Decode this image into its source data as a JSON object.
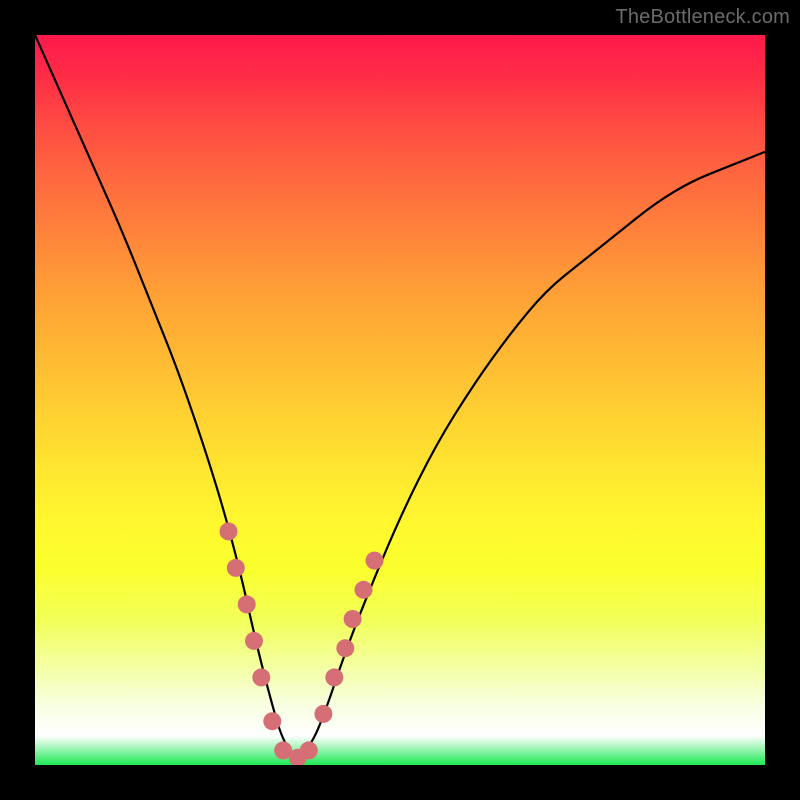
{
  "watermark": "TheBottleneck.com",
  "colors": {
    "page_bg": "#000000",
    "dot": "#d66f75",
    "curve": "#000000",
    "gradient_top": "#ff184c",
    "gradient_bottom": "#1de953"
  },
  "chart_data": {
    "type": "line",
    "title": "",
    "xlabel": "",
    "ylabel": "",
    "xlim": [
      0,
      100
    ],
    "ylim": [
      0,
      100
    ],
    "series": [
      {
        "name": "bottleneck-curve",
        "note": "V-shaped curve; minimum (optimal point) near x≈35, y≈0. Values read from pixel positions; image has no numeric axis labels.",
        "x": [
          0,
          4,
          8,
          12,
          16,
          20,
          25,
          28,
          30,
          32,
          34,
          36,
          38,
          40,
          42,
          45,
          50,
          55,
          60,
          65,
          70,
          75,
          80,
          85,
          90,
          95,
          100
        ],
        "y": [
          100,
          91,
          82,
          73,
          63,
          53,
          38,
          27,
          18,
          10,
          3,
          1,
          3,
          8,
          14,
          22,
          34,
          44,
          52,
          59,
          65,
          69,
          73,
          77,
          80,
          82,
          84
        ]
      }
    ],
    "highlight_points": {
      "name": "near-optimal-range",
      "note": "Salmon-colored dots marking the region close to the curve minimum on both branches.",
      "x": [
        26.5,
        27.5,
        29,
        30,
        31,
        32.5,
        34,
        36,
        37.5,
        39.5,
        41,
        42.5,
        43.5,
        45,
        46.5
      ],
      "y": [
        32,
        27,
        22,
        17,
        12,
        6,
        2,
        1,
        2,
        7,
        12,
        16,
        20,
        24,
        28
      ]
    },
    "optimum_x": 35
  }
}
